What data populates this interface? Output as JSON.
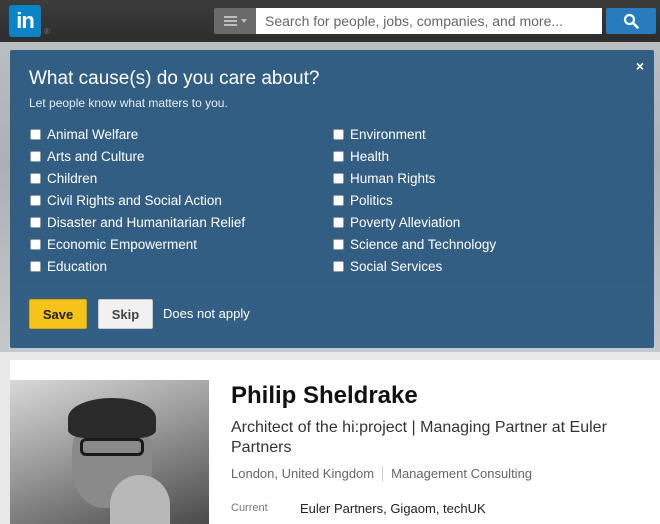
{
  "topbar": {
    "logo_text": "in",
    "logo_reg": "®",
    "search_placeholder": "Search for people, jobs, companies, and more...",
    "brand_color": "#0a84c6"
  },
  "modal": {
    "title": "What cause(s) do you care about?",
    "subtitle": "Let people know what matters to you.",
    "close_label": "×",
    "causes_left": [
      "Animal Welfare",
      "Arts and Culture",
      "Children",
      "Civil Rights and Social Action",
      "Disaster and Humanitarian Relief",
      "Economic Empowerment",
      "Education"
    ],
    "causes_right": [
      "Environment",
      "Health",
      "Human Rights",
      "Politics",
      "Poverty Alleviation",
      "Science and Technology",
      "Social Services"
    ],
    "save_label": "Save",
    "skip_label": "Skip",
    "not_apply_label": "Does not apply"
  },
  "profile": {
    "name": "Philip Sheldrake",
    "headline": "Architect of the hi:project | Managing Partner at Euler Partners",
    "location": "London, United Kingdom",
    "industry": "Management Consulting",
    "current_label": "Current",
    "current_value": "Euler Partners, Gigaom, techUK"
  }
}
